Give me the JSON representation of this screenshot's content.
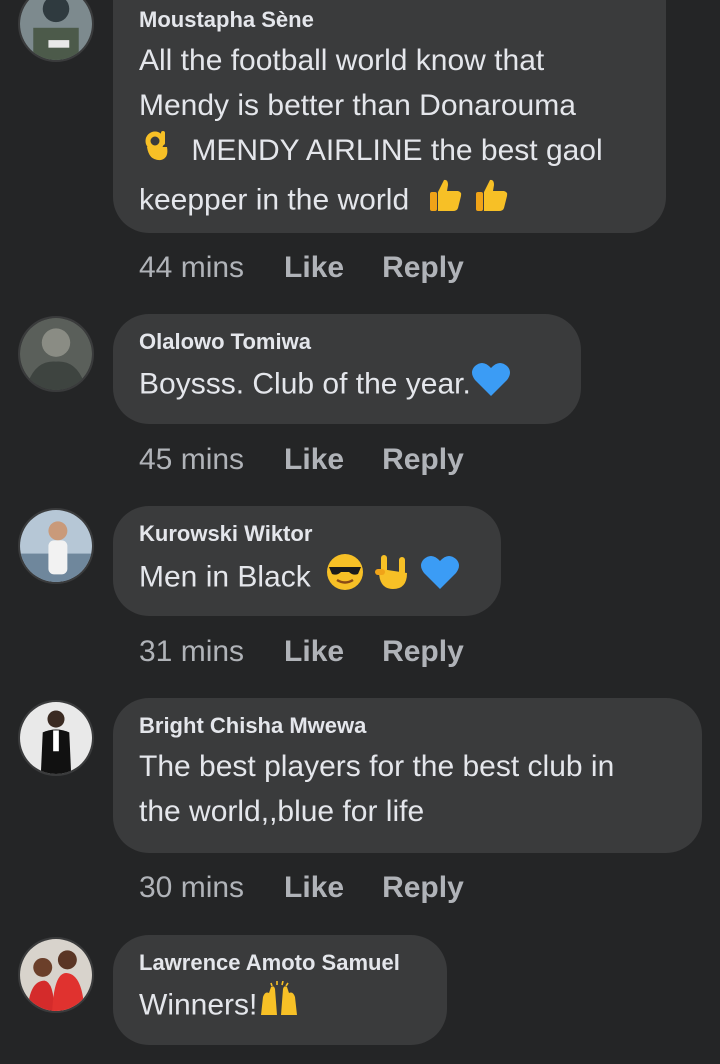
{
  "comments": [
    {
      "author": "Moustapha Sène",
      "lines": [
        "All the football world know that",
        "Mendy is better than Donarouma",
        "MENDY AIRLINE the best gaol",
        "keepper in the world"
      ],
      "time": "44 mins",
      "like_label": "Like",
      "reply_label": "Reply",
      "emojis": [
        "ok-hand-emoji",
        "thumbs-up-emoji",
        "thumbs-up-emoji"
      ]
    },
    {
      "author": "Olalowo Tomiwa",
      "lines": [
        "Boysss. Club of the year."
      ],
      "time": "45 mins",
      "like_label": "Like",
      "reply_label": "Reply",
      "emojis": [
        "blue-heart-emoji"
      ]
    },
    {
      "author": "Kurowski Wiktor",
      "lines": [
        "Men in Black"
      ],
      "time": "31 mins",
      "like_label": "Like",
      "reply_label": "Reply",
      "emojis": [
        "sunglasses-face-emoji",
        "sign-of-horns-emoji",
        "blue-heart-emoji"
      ]
    },
    {
      "author": "Bright Chisha Mwewa",
      "lines": [
        "The best players for the best club in",
        "the world,,blue for life"
      ],
      "time": "30 mins",
      "like_label": "Like",
      "reply_label": "Reply",
      "emojis": []
    },
    {
      "author": "Lawrence Amoto Samuel",
      "lines": [
        "Winners!"
      ],
      "emojis": [
        "raising-hands-emoji"
      ]
    }
  ],
  "colors": {
    "background": "#242526",
    "bubble": "#3a3b3c",
    "text_primary": "#e4e6eb",
    "text_secondary": "#b0b3b8",
    "emoji_yellow": "#f7c026",
    "heart_blue": "#3b9cf5"
  }
}
